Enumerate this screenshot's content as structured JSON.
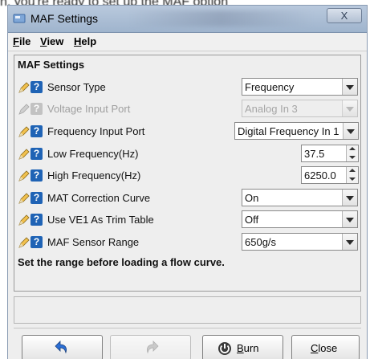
{
  "background_text": "n, you're ready to set up the MAF option",
  "window": {
    "title": "MAF Settings",
    "close_glyph": "X"
  },
  "menu": [
    {
      "label": "File",
      "underline": "F",
      "rest": "ile"
    },
    {
      "label": "View",
      "underline": "V",
      "rest": "iew"
    },
    {
      "label": "Help",
      "underline": "H",
      "rest": "elp"
    }
  ],
  "panel": {
    "title": "MAF Settings",
    "rows": [
      {
        "label": "Sensor Type",
        "control": "select",
        "value": "Frequency",
        "enabled": true
      },
      {
        "label": "Voltage Input Port",
        "control": "select",
        "value": "Analog In 3",
        "enabled": false
      },
      {
        "label": "Frequency Input Port",
        "control": "select",
        "value": "Digital Frequency In 1",
        "enabled": true
      },
      {
        "label": "Low Frequency(Hz)",
        "control": "spinner",
        "value": "37.5",
        "enabled": true
      },
      {
        "label": "High Frequency(Hz)",
        "control": "spinner",
        "value": "6250.0",
        "enabled": true
      },
      {
        "label": "MAT Correction Curve",
        "control": "select",
        "value": "On",
        "enabled": true
      },
      {
        "label": "Use VE1 As Trim Table",
        "control": "select",
        "value": "Off",
        "enabled": true
      },
      {
        "label": "MAF Sensor Range",
        "control": "select",
        "value": "650g/s",
        "enabled": true
      }
    ],
    "note": "Set the range before loading a flow curve."
  },
  "buttons": {
    "undo_icon": "undo-icon",
    "redo_icon": "redo-icon",
    "burn": {
      "underline": "B",
      "rest": "urn"
    },
    "close": {
      "underline": "C",
      "rest": "lose"
    }
  },
  "colors": {
    "help_icon": "#1f63b5",
    "title_bar": "#b9c9dd",
    "window_bg": "#eeeeee"
  }
}
